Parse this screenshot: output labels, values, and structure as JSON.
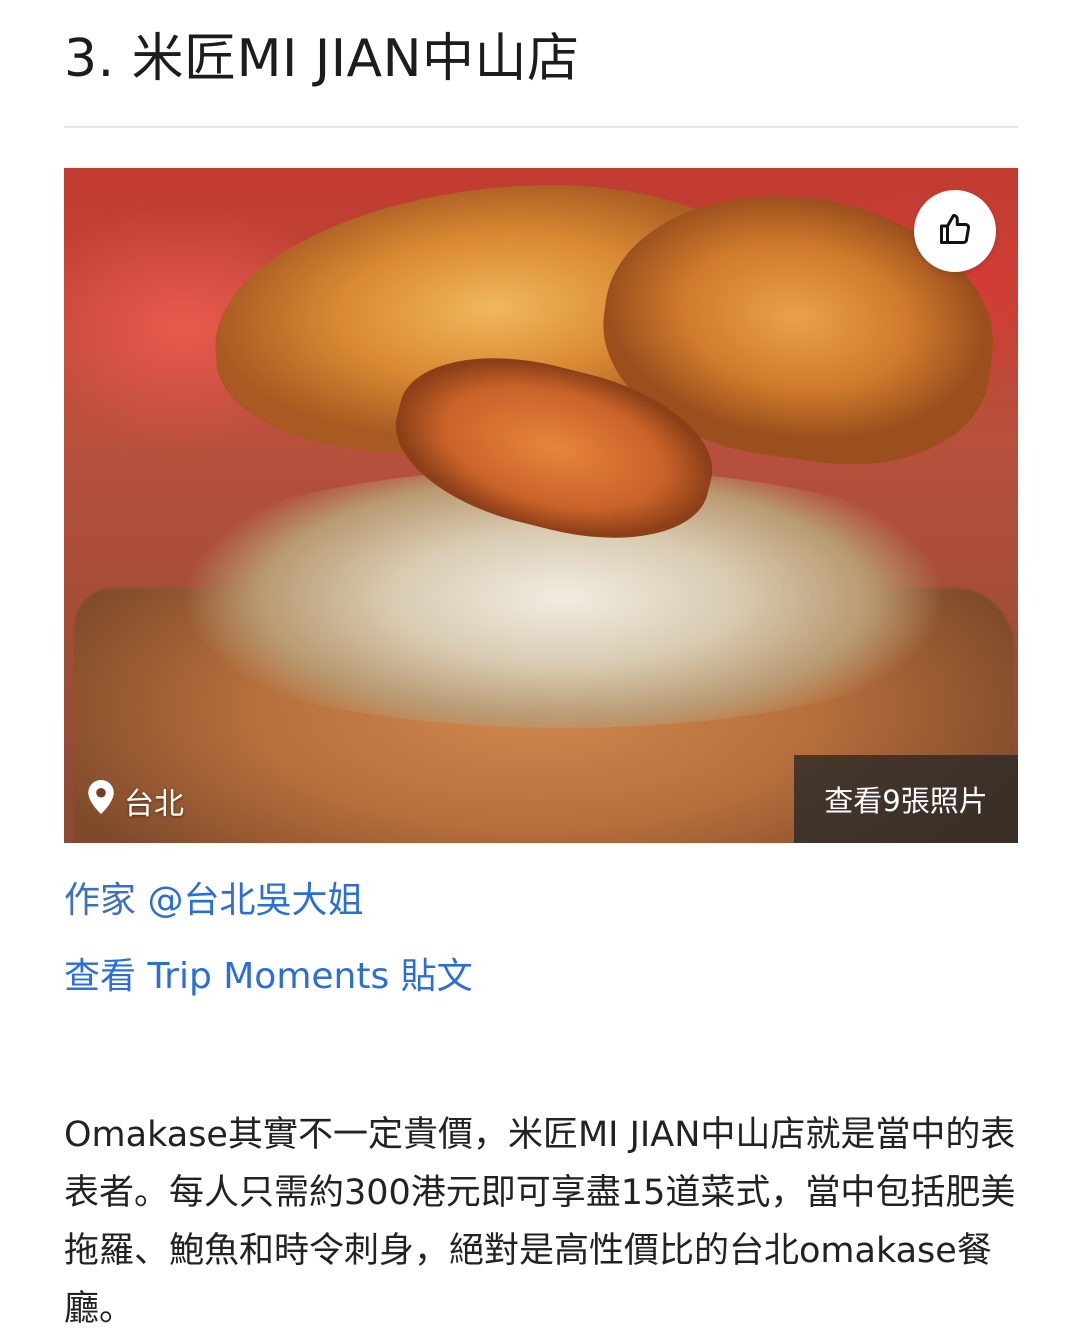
{
  "article": {
    "title": "3. 米匠MI JIAN中山店",
    "hero": {
      "image_description": "Close-up of sea urchin atop rice and fried tofu skin",
      "location_icon": "map-pin-icon",
      "location": "台北",
      "photos_label": "查看9張照片",
      "like_icon": "thumbs-up-icon"
    },
    "author_prefix": "作家",
    "author_handle": "@台北吳大姐",
    "moments_link": "查看 Trip Moments 貼文",
    "description": "Omakase其實不一定貴價，米匠MI JIAN中山店就是當中的表表者。每人只需約300港元即可享盡15道菜式，當中包括肥美拖羅、鮑魚和時令刺身，絕對是高性價比的台北omakase餐廳。"
  },
  "colors": {
    "link": "#2b6fd6",
    "title": "#1c1c1c",
    "body_text": "#222222",
    "photo_overlay": "#282828"
  }
}
